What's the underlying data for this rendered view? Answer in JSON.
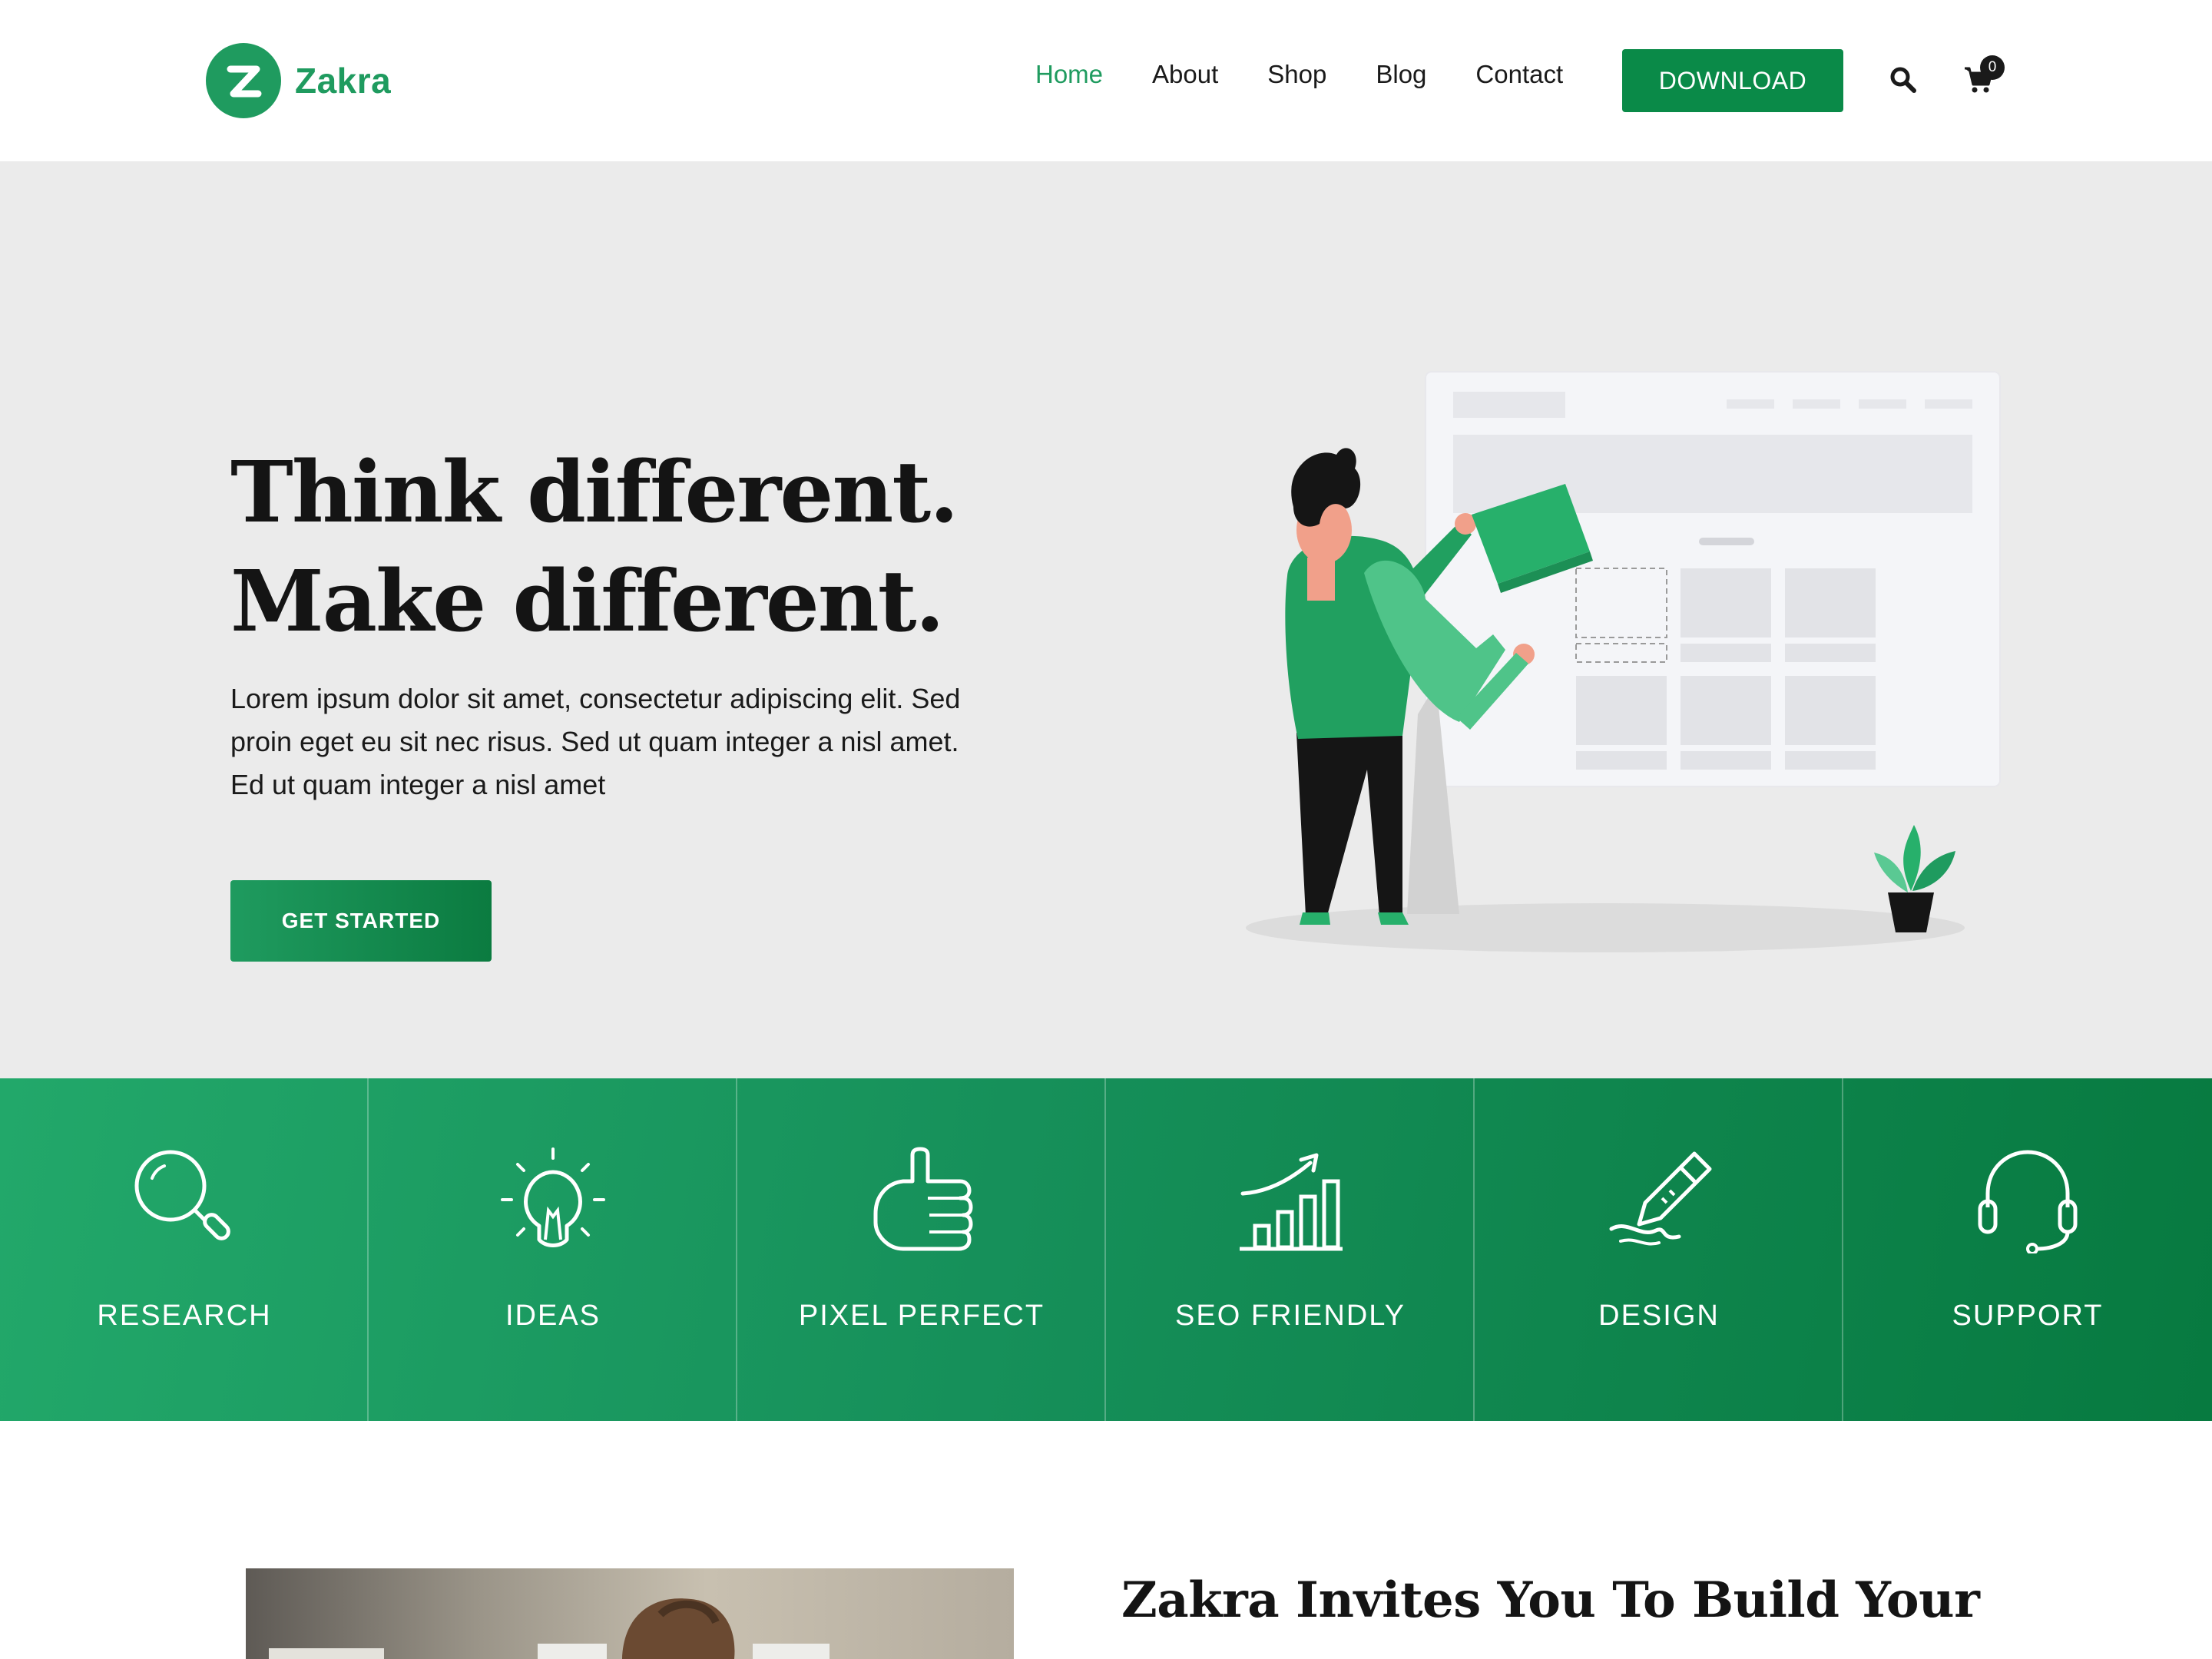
{
  "brand": {
    "name": "Zakra",
    "accent": "#1f9b5f"
  },
  "nav": {
    "items": [
      {
        "label": "Home",
        "active": true
      },
      {
        "label": "About",
        "active": false
      },
      {
        "label": "Shop",
        "active": false
      },
      {
        "label": "Blog",
        "active": false
      },
      {
        "label": "Contact",
        "active": false
      }
    ],
    "download_label": "DOWNLOAD",
    "cart_count": "0"
  },
  "hero": {
    "title_line1": "Think different.",
    "title_line2": "Make different.",
    "description": "Lorem ipsum dolor sit amet, consectetur adipiscing elit. Sed proin eget eu sit nec risus. Sed ut quam integer a nisl amet.  Ed ut quam integer a nisl amet",
    "cta_label": "GET STARTED"
  },
  "features": [
    {
      "label": "RESEARCH",
      "icon": "magnifier-icon"
    },
    {
      "label": "IDEAS",
      "icon": "lightbulb-icon"
    },
    {
      "label": "PIXEL PERFECT",
      "icon": "thumbs-up-icon"
    },
    {
      "label": "SEO FRIENDLY",
      "icon": "growth-chart-icon"
    },
    {
      "label": "DESIGN",
      "icon": "pen-icon"
    },
    {
      "label": "SUPPORT",
      "icon": "headset-icon"
    }
  ],
  "section": {
    "title": "Zakra Invites You To Build Your"
  }
}
